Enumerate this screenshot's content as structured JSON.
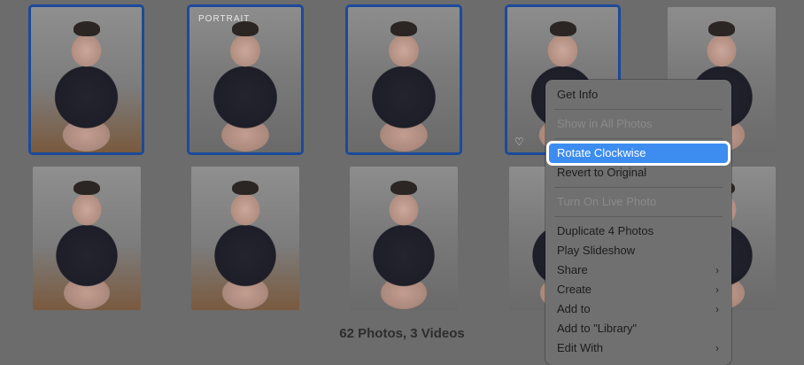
{
  "grid": {
    "row1": [
      {
        "badge": "",
        "selected": true
      },
      {
        "badge": "PORTRAIT",
        "selected": true
      },
      {
        "badge": "",
        "selected": true
      },
      {
        "badge": "",
        "selected": true,
        "heart": "♡"
      },
      {
        "badge": "",
        "selected": false
      }
    ],
    "row2_count": 5
  },
  "footer": {
    "count_text": "62 Photos, 3 Videos"
  },
  "menu": {
    "items": [
      {
        "label": "Get Info",
        "enabled": true
      },
      {
        "label": "Show in All Photos",
        "enabled": false
      },
      {
        "label": "Rotate Clockwise",
        "enabled": true,
        "highlighted": true
      },
      {
        "label": "Revert to Original",
        "enabled": true
      },
      {
        "label": "Turn On Live Photo",
        "enabled": false
      },
      {
        "label": "Duplicate 4 Photos",
        "enabled": true
      },
      {
        "label": "Play Slideshow",
        "enabled": true
      },
      {
        "label": "Share",
        "enabled": true,
        "submenu": true
      },
      {
        "label": "Create",
        "enabled": true,
        "submenu": true
      },
      {
        "label": "Add to",
        "enabled": true,
        "submenu": true
      },
      {
        "label": "Add to \"Library\"",
        "enabled": true
      },
      {
        "label": "Edit With",
        "enabled": true,
        "submenu": true
      }
    ],
    "submenu_icon": "chevron-right-icon",
    "highlight_color": "#3d8cf0"
  }
}
